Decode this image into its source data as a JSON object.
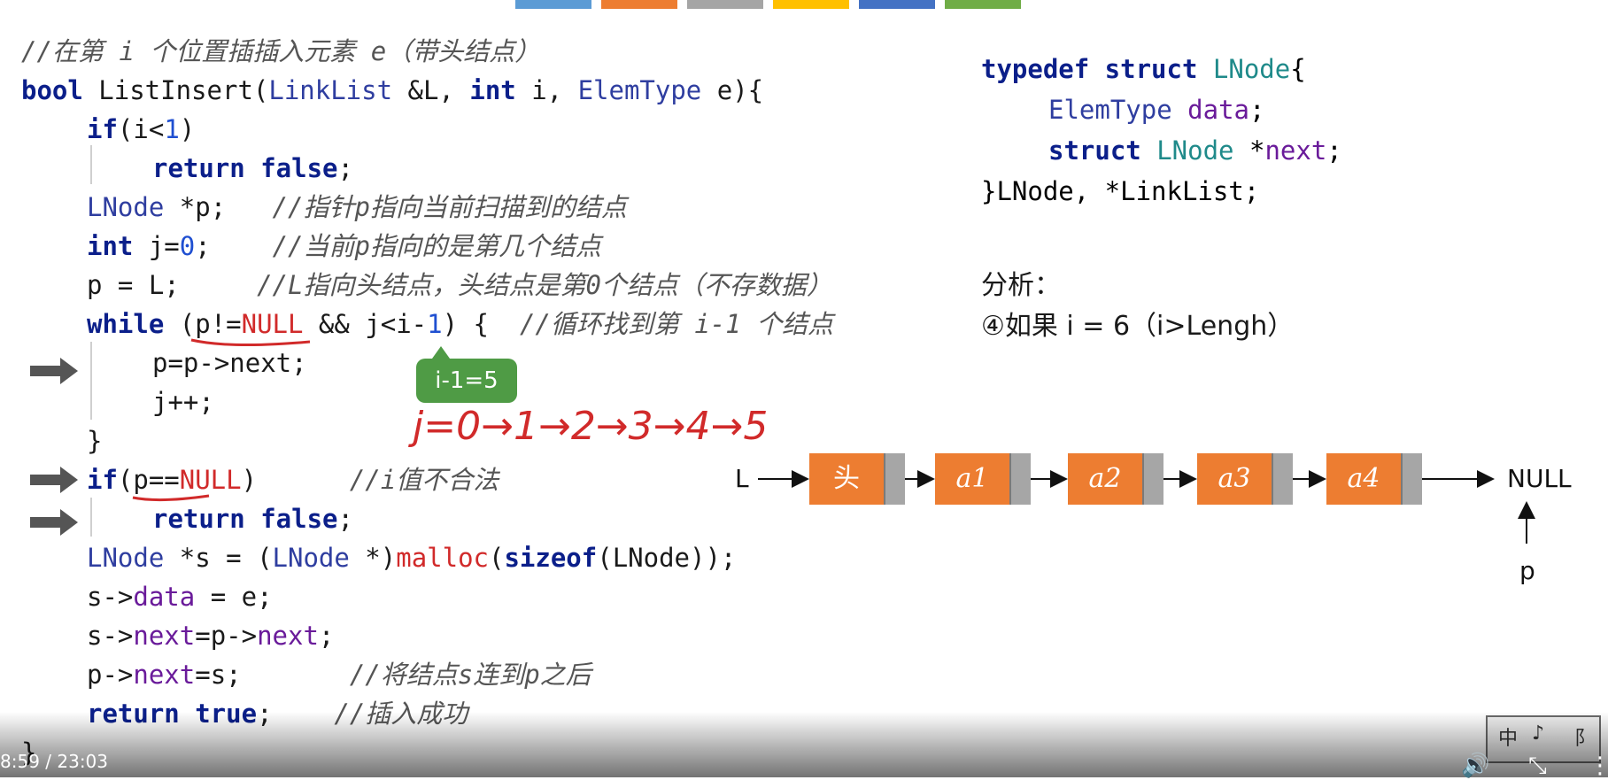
{
  "progress_colors": [
    "#5b9bd5",
    "#ed7d31",
    "#a5a5a5",
    "#ffc000",
    "#4472c4",
    "#70ad47"
  ],
  "code": {
    "comment_line": "//在第 i 个位置插插入元素 e（带头结点）",
    "sig_kw": "bool",
    "sig_name": " ListInsert(",
    "sig_type1": "LinkList",
    "sig_mid1": " &L, ",
    "sig_kw2": "int",
    "sig_mid2": " i, ",
    "sig_type2": "ElemType",
    "sig_end": " e){",
    "if1_kw": "if",
    "if1_a": "(i<",
    "if1_num": "1",
    "if1_b": ")",
    "ret1_kw": "return false",
    "ret1_end": ";",
    "p_decl_type": "LNode",
    "p_decl_rest": " *p;   ",
    "p_decl_cm": "//指针p指向当前扫描到的结点",
    "j_decl_kw": "int",
    "j_decl_a": " j=",
    "j_decl_num": "0",
    "j_decl_b": ";    ",
    "j_decl_cm": "//当前p指向的是第几个结点",
    "pl_code": "p = L;     ",
    "pl_cm": "//L指向头结点，头结点是第0个结点（不存数据）",
    "while_kw": "while",
    "while_a": " (p!=",
    "while_null": "NULL",
    "while_b": " && j<i-",
    "while_num": "1",
    "while_c": ") {  ",
    "while_cm": "//循环找到第 i-1 个结点",
    "loop1": "p=p->next;",
    "loop2": "j++;",
    "close1": "}",
    "if2_kw": "if",
    "if2_a": "(p==",
    "if2_null": "NULL",
    "if2_b": ")      ",
    "if2_cm": "//i值不合法",
    "ret2_kw": "return false",
    "ret2_end": ";",
    "s_type": "LNode",
    "s_a": " *s = (",
    "s_type2": "LNode",
    "s_b": " *)",
    "s_malloc": "malloc",
    "s_c": "(",
    "s_sizeof": "sizeof",
    "s_d": "(LNode));",
    "sdata_a": "s->",
    "sdata_f": "data",
    "sdata_b": " = e;",
    "snext_a": "s->",
    "snext_f": "next",
    "snext_b": "=p->",
    "snext_f2": "next",
    "snext_c": ";",
    "pnext_a": "p->",
    "pnext_f": "next",
    "pnext_b": "=s;       ",
    "pnext_cm": "//将结点s连到p之后",
    "rett_kw": "return true",
    "rett_end": ";    ",
    "rett_cm": "//插入成功",
    "close2": "}"
  },
  "struct": {
    "l1_kw": "typedef struct ",
    "l1_name": "LNode",
    "l1_end": "{",
    "l2_type": "ElemType",
    "l2_field": " data",
    "l2_end": ";",
    "l3_kw": "struct ",
    "l3_type": "LNode",
    "l3_a": " *",
    "l3_field": "next",
    "l3_end": ";",
    "l4": "}LNode, *LinkList;"
  },
  "analysis": {
    "title": "分析：",
    "line": "④如果 i = 6（i>Lengh）"
  },
  "bubble": "i-1=5",
  "handwriting": "j=0→1→2→3→4→5",
  "diagram": {
    "l_label": "L",
    "nodes": [
      "头",
      "a1",
      "a2",
      "a3",
      "a4"
    ],
    "null_label": "NULL",
    "p_label": "p"
  },
  "player": {
    "time": "8:59 / 23:03",
    "volume_icon": "🔊",
    "fullscreen_icon": "⤡",
    "more_icon": "⋮"
  },
  "watermark": {
    "c1": "中",
    "c2": "♪",
    "c3": "⻏"
  }
}
